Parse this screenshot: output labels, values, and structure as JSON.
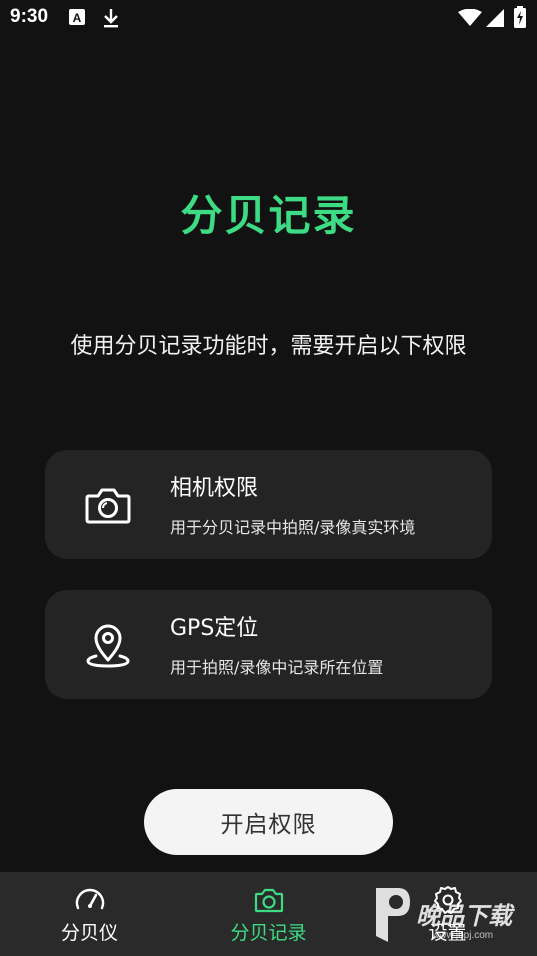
{
  "status_bar": {
    "time": "9:30"
  },
  "main": {
    "title": "分贝记录",
    "subtitle": "使用分贝记录功能时，需要开启以下权限"
  },
  "permissions": [
    {
      "title": "相机权限",
      "description": "用于分贝记录中拍照/录像真实环境",
      "icon": "camera-icon"
    },
    {
      "title": "GPS定位",
      "description": "用于拍照/录像中记录所在位置",
      "icon": "location-pin-icon"
    }
  ],
  "button": {
    "label": "开启权限"
  },
  "bottom_nav": {
    "items": [
      {
        "label": "分贝仪",
        "icon": "gauge-icon",
        "active": false
      },
      {
        "label": "分贝记录",
        "icon": "camera-icon",
        "active": true
      },
      {
        "label": "设置",
        "icon": "gear-icon",
        "active": false
      }
    ]
  },
  "watermark": {
    "text": "晚品下载",
    "url": "www.jbpj.com"
  },
  "colors": {
    "accent": "#3ddc84",
    "background": "#121212",
    "card": "#242424",
    "nav_background": "#2a2a2a"
  }
}
